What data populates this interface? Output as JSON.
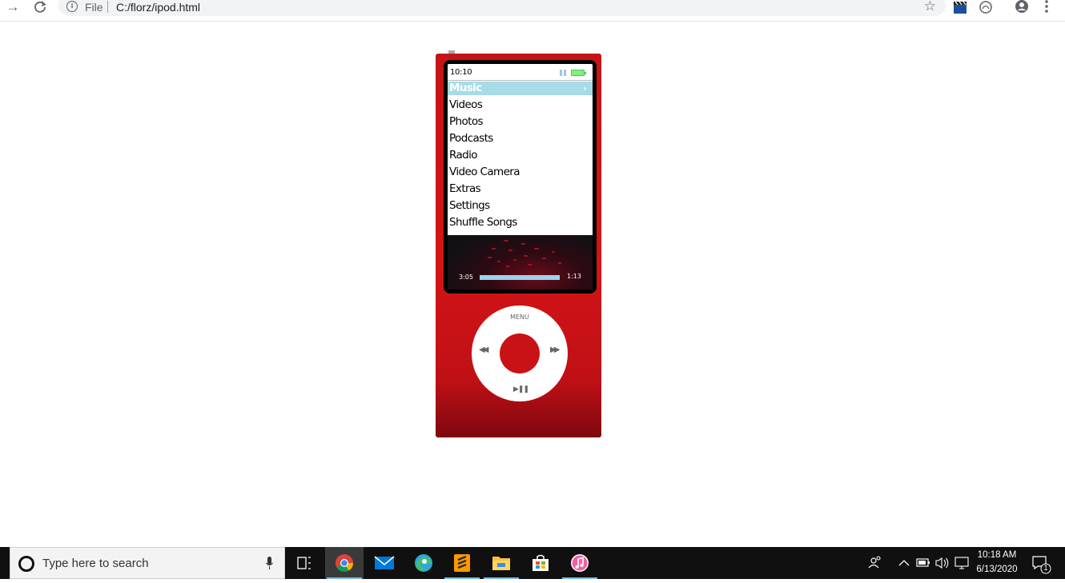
{
  "browser": {
    "info_label": "i",
    "scheme_label": "File",
    "url": "C:/florz/ipod.html"
  },
  "ipod": {
    "clock": "10:10",
    "menu": [
      {
        "label": "Music",
        "selected": true
      },
      {
        "label": "Videos"
      },
      {
        "label": "Photos"
      },
      {
        "label": "Podcasts"
      },
      {
        "label": "Radio"
      },
      {
        "label": "Video Camera"
      },
      {
        "label": "Extras"
      },
      {
        "label": "Settings"
      },
      {
        "label": "Shuffle Songs"
      }
    ],
    "chevron": "›",
    "elapsed": "3:05",
    "remaining": "1:13",
    "progress": 1.0,
    "wheel": {
      "menu_label": "MENU",
      "prev_glyph": "◀◀",
      "next_glyph": "▶▶",
      "play_glyph": "▶❚❚"
    }
  },
  "taskbar": {
    "search_placeholder": "Type here to search",
    "time": "10:18 AM",
    "date": "6/13/2020",
    "notification_count": "1"
  },
  "colors": {
    "ipod_red": "#c51418",
    "selection_blue": "#a7dbe8",
    "taskbar": "#101010"
  }
}
